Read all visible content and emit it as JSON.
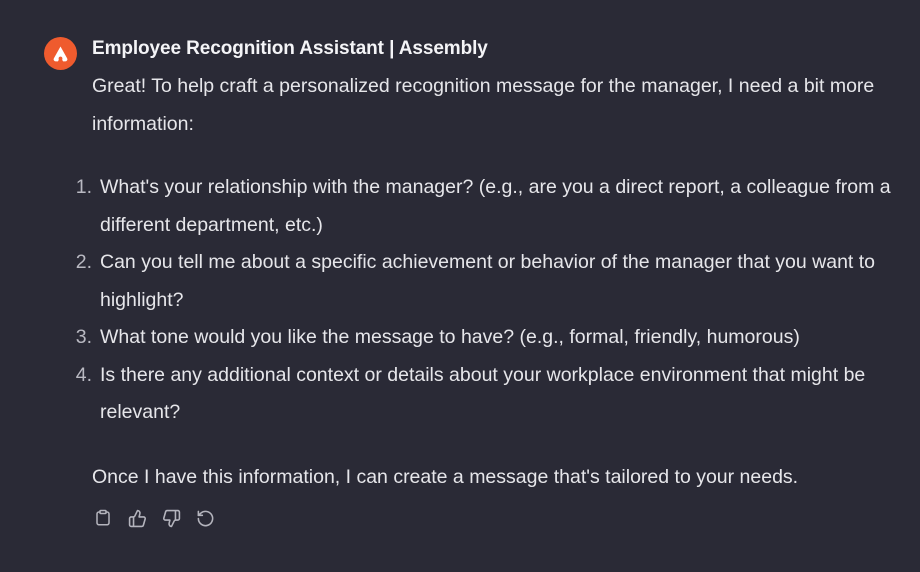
{
  "message": {
    "sender": "Employee Recognition Assistant | Assembly",
    "avatar_icon": "assembly-logo-icon",
    "intro": "Great! To help craft a personalized recognition message for the manager, I need a bit more information:",
    "questions": [
      {
        "number": "1.",
        "text": "What's your relationship with the manager? (e.g., are you a direct report, a colleague from a different department, etc.)"
      },
      {
        "number": "2.",
        "text": "Can you tell me about a specific achievement or behavior of the manager that you want to highlight?"
      },
      {
        "number": "3.",
        "text": "What tone would you like the message to have? (e.g., formal, friendly, humorous)"
      },
      {
        "number": "4.",
        "text": "Is there any additional context or details about your workplace environment that might be relevant?"
      }
    ],
    "outro": "Once I have this information, I can create a message that's tailored to your needs.",
    "actions": [
      {
        "name": "copy-icon"
      },
      {
        "name": "thumbs-up-icon"
      },
      {
        "name": "thumbs-down-icon"
      },
      {
        "name": "regenerate-icon"
      }
    ]
  },
  "colors": {
    "background": "#2a2a36",
    "text": "#e6e6ea",
    "accent": "#ef5b2e",
    "icon": "#b4b4bd"
  }
}
